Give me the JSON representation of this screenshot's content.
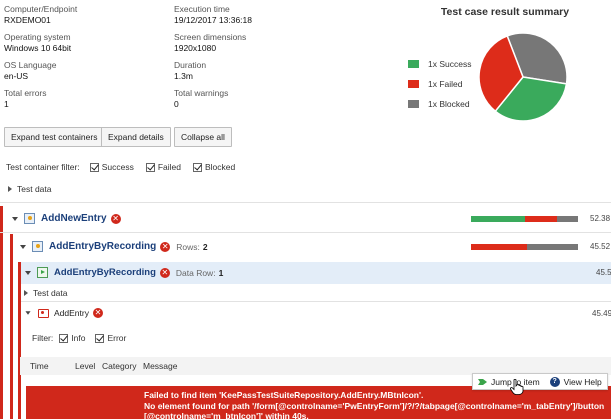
{
  "info": {
    "computer_label": "Computer/Endpoint",
    "computer_value": "RXDEMO01",
    "exec_label": "Execution time",
    "exec_value": "19/12/2017 13:36:18",
    "os_label": "Operating system",
    "os_value": "Windows 10 64bit",
    "screen_label": "Screen dimensions",
    "screen_value": "1920x1080",
    "lang_label": "OS Language",
    "lang_value": "en-US",
    "duration_label": "Duration",
    "duration_value": "1.3m",
    "errors_label": "Total errors",
    "errors_value": "1",
    "warnings_label": "Total warnings",
    "warnings_value": "0"
  },
  "summary": {
    "title": "Test case result summary",
    "legend": [
      {
        "label": "1x Success",
        "color": "#3aaa5c"
      },
      {
        "label": "1x Failed",
        "color": "#dd2c1a"
      },
      {
        "label": "1x Blocked",
        "color": "#777777"
      }
    ],
    "slices": [
      {
        "name": "Success",
        "value": 1,
        "color": "#3aaa5c"
      },
      {
        "name": "Failed",
        "value": 1,
        "color": "#dd2c1a"
      },
      {
        "name": "Blocked",
        "value": 1,
        "color": "#777777"
      }
    ]
  },
  "toolbar": {
    "expand_containers": "Expand test containers",
    "expand_details": "Expand details",
    "collapse_all": "Collapse all"
  },
  "filter": {
    "label": "Test container filter:",
    "success": "Success",
    "failed": "Failed",
    "blocked": "Blocked"
  },
  "test_data_label": "Test data",
  "nodes": {
    "n1": {
      "name": "AddNewEntry",
      "duration": "52.38",
      "progress": [
        0.5,
        0.3,
        0.2
      ]
    },
    "n2": {
      "name": "AddEntryByRecording",
      "rows_label": "Rows:",
      "rows_value": "2",
      "duration": "45.52",
      "progress": [
        0.5,
        0.0,
        0.5
      ]
    },
    "n3": {
      "name": "AddEntryByRecording",
      "data_row_label": "Data Row:",
      "data_row_value": "1",
      "duration": "45.5"
    },
    "test_data": "Test data",
    "module": {
      "name": "AddEntry",
      "duration": "45.49"
    }
  },
  "module_filter": {
    "label": "Filter:",
    "info": "Info",
    "error": "Error"
  },
  "columns": {
    "time": "Time",
    "level": "Level",
    "category": "Category",
    "message": "Message"
  },
  "error": {
    "line1": "Failed to find item 'KeePassTestSuiteRepository.AddEntry.MBtnIcon'.",
    "line2": "No element found for path '/form[@controlname='PwEntryForm']/?/?/tabpage[@controlname='m_tabEntry']/button",
    "line3": "[@controlname='m_btnIcon']' within 40s."
  },
  "popup": {
    "jump": "Jump to item",
    "help": "View Help"
  },
  "colors": {
    "success": "#3aaa5c",
    "failed": "#dd2c1a",
    "blocked": "#777777",
    "accent": "#1b3f7a"
  }
}
